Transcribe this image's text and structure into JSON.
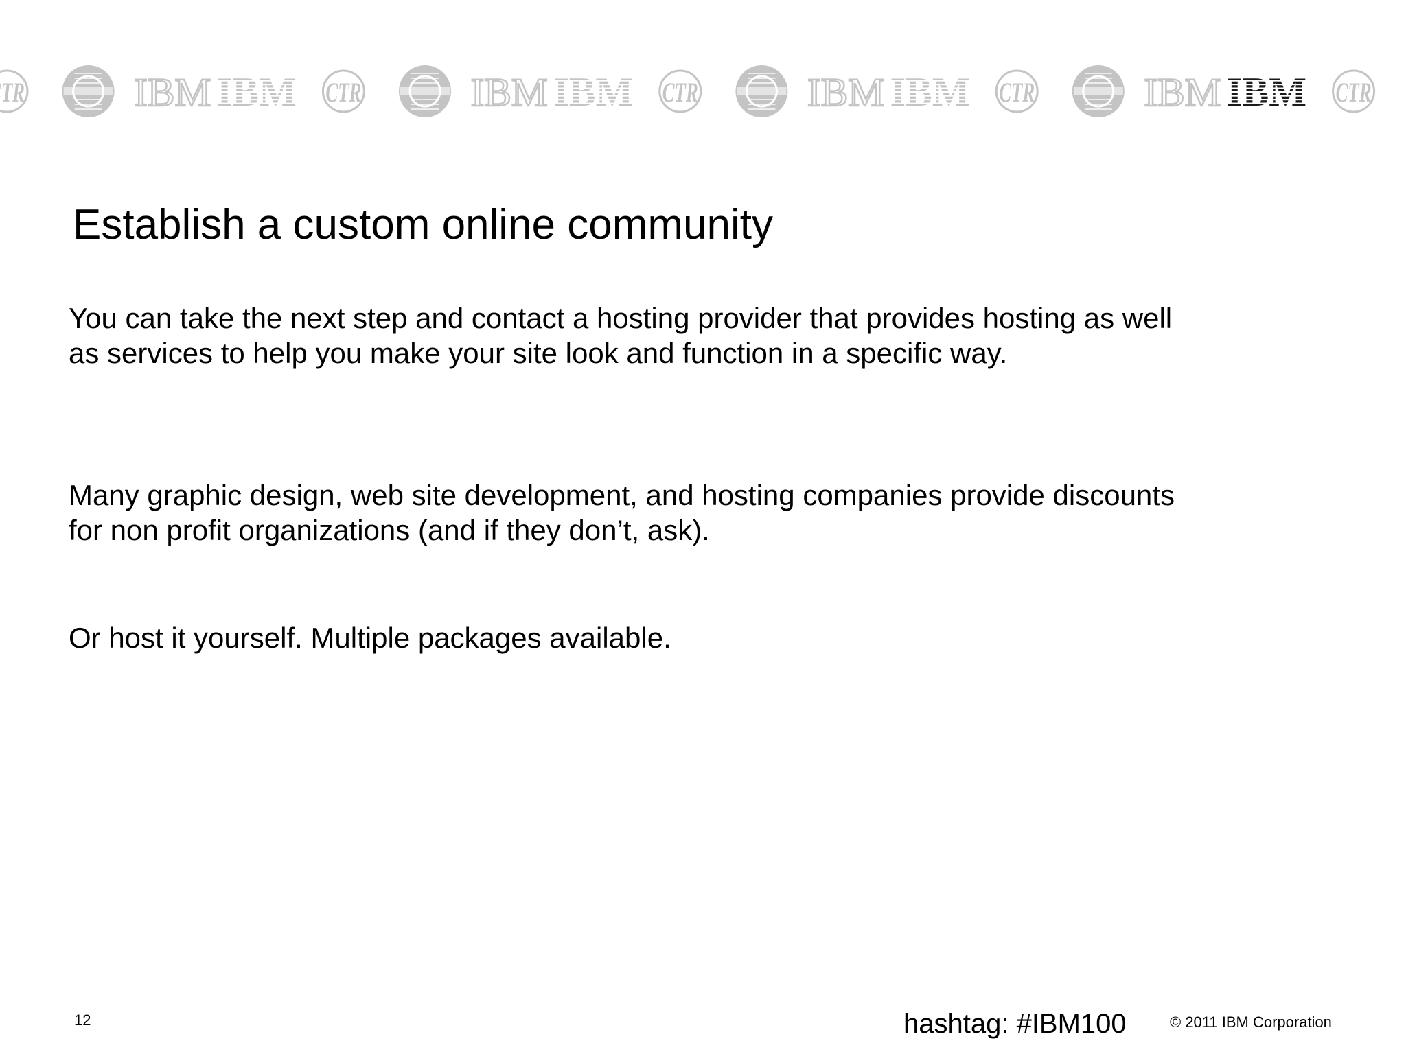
{
  "banner": {
    "logos": [
      {
        "kind": "ctr",
        "text": "CTR",
        "active": false
      },
      {
        "kind": "seal",
        "text": "BUSINESS INTERNATIONAL MACHINES",
        "active": false
      },
      {
        "kind": "ibm-serif",
        "text": "IBM",
        "active": false
      },
      {
        "kind": "ibm-striped",
        "text": "IBM",
        "active": false
      },
      {
        "kind": "ctr",
        "text": "CTR",
        "active": false
      },
      {
        "kind": "seal",
        "text": "BUSINESS INTERNATIONAL MACHINES",
        "active": false
      },
      {
        "kind": "ibm-serif",
        "text": "IBM",
        "active": false
      },
      {
        "kind": "ibm-striped",
        "text": "IBM",
        "active": false
      },
      {
        "kind": "ctr",
        "text": "CTR",
        "active": false
      },
      {
        "kind": "seal",
        "text": "BUSINESS INTERNATIONAL MACHINES",
        "active": false
      },
      {
        "kind": "ibm-serif",
        "text": "IBM",
        "active": false
      },
      {
        "kind": "ibm-striped",
        "text": "IBM",
        "active": false
      },
      {
        "kind": "ctr",
        "text": "CTR",
        "active": false
      },
      {
        "kind": "seal",
        "text": "BUSINESS INTERNATIONAL MACHINES",
        "active": false
      },
      {
        "kind": "ibm-serif",
        "text": "IBM",
        "active": false
      },
      {
        "kind": "ibm-striped",
        "text": "IBM",
        "active": true
      },
      {
        "kind": "ctr",
        "text": "CTR",
        "active": false
      },
      {
        "kind": "seal",
        "text": "BUSINESS INTERNATIONAL MACHINES",
        "active": false
      }
    ],
    "colors": {
      "faded": "#c4c4c4",
      "active": "#1a1a1a"
    }
  },
  "title": "Establish a custom online community",
  "paragraphs": [
    "You can take the next step and contact a hosting provider that provides hosting as well as services to help you make your site look and function in a specific way.",
    "Many graphic design, web site development, and hosting companies provide discounts for non profit organizations (and if they don’t, ask).",
    "Or host it yourself.  Multiple packages available."
  ],
  "footer": {
    "page_number": "12",
    "hashtag": "hashtag:  #IBM100",
    "copyright": "© 2011 IBM Corporation"
  }
}
